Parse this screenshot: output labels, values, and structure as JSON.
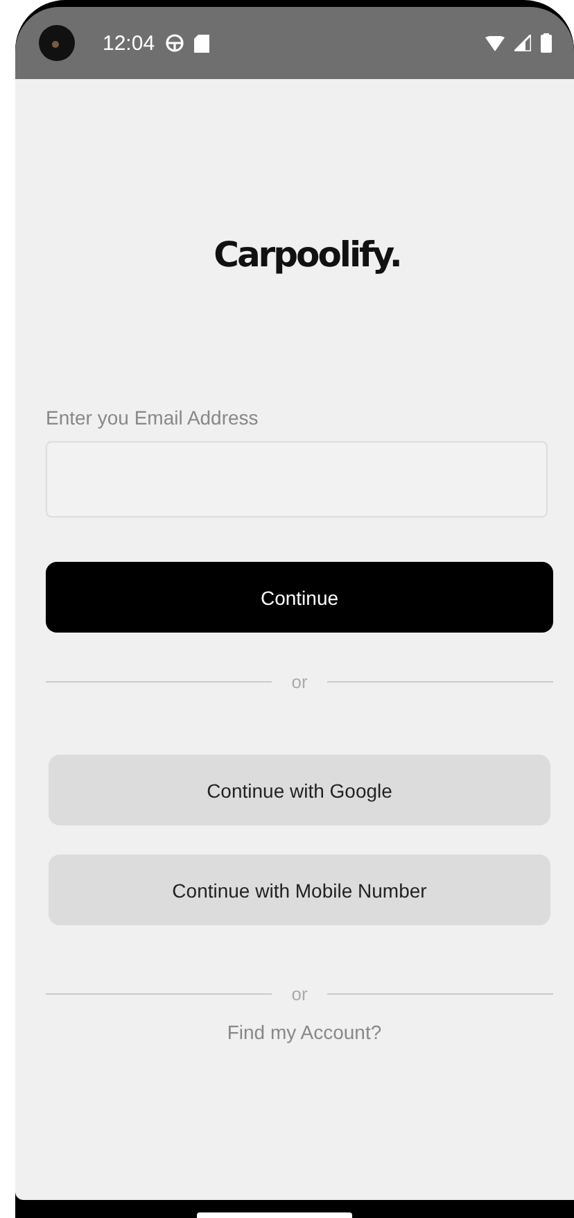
{
  "status_bar": {
    "time": "12:04"
  },
  "logo": "Carpoolify.",
  "email": {
    "label": "Enter you Email Address"
  },
  "continue_button": "Continue",
  "dividers": [
    "or",
    "or"
  ],
  "social_buttons": [
    "Continue with Google",
    "Continue with Mobile Number"
  ],
  "find_account_link": "Find my Account?"
}
